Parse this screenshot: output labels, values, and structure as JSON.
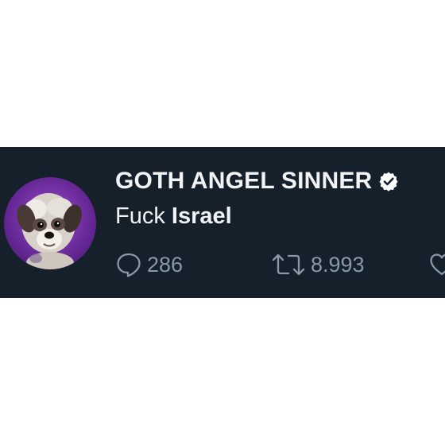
{
  "tweet": {
    "display_name": "GOTH ANGEL SINNER",
    "verified_icon": "verified-badge-icon",
    "text_plain": "Fuck ",
    "text_bold": "Israel",
    "reply_icon": "speech-bubble-icon",
    "reply_count": "286",
    "retweet_icon": "retweet-arrows-icon",
    "retweet_count": "8.993",
    "like_icon": "heart-icon"
  },
  "colors": {
    "card_background": "#15202b",
    "text_primary": "#f1f3f5",
    "text_secondary": "#8899a6",
    "avatar_background": "#7a34b0"
  }
}
